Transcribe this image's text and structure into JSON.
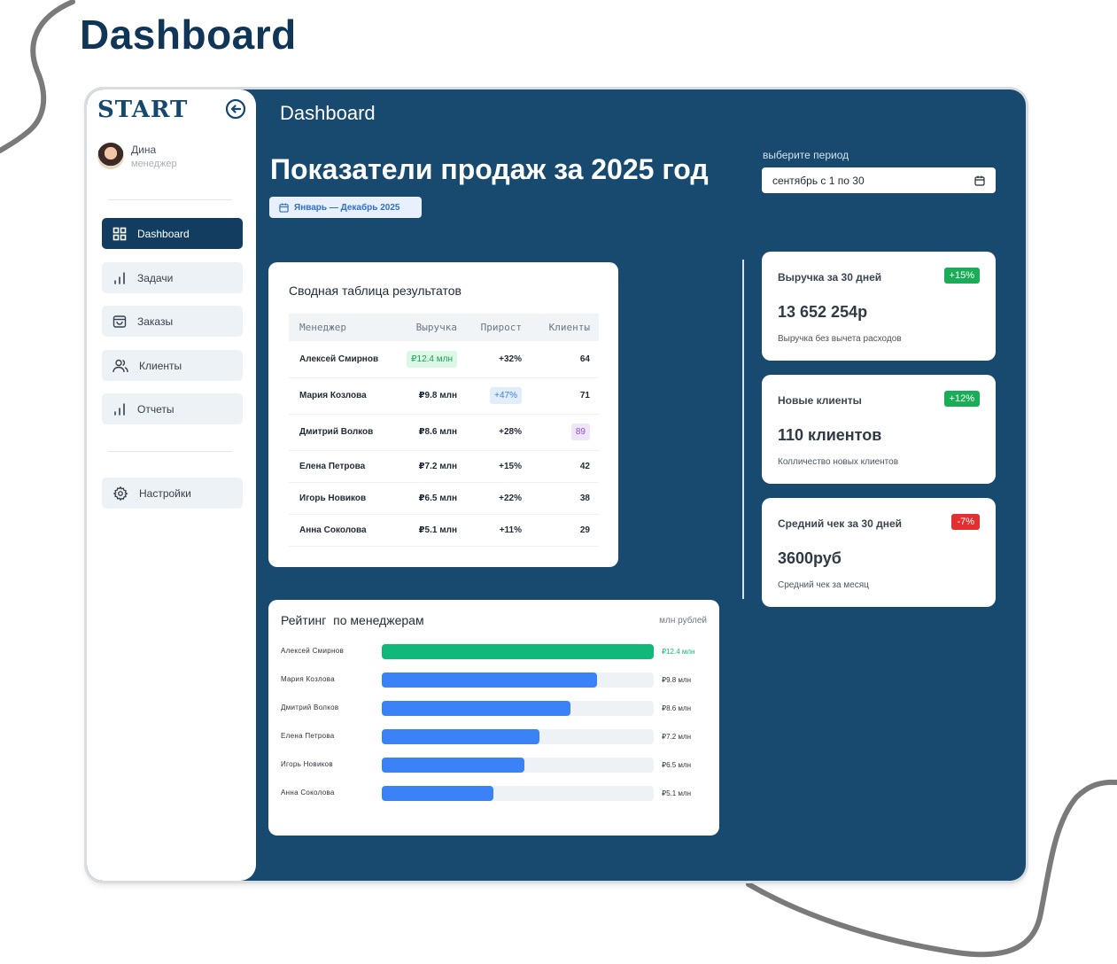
{
  "page_title": "Dashboard",
  "sidebar": {
    "brand": "START",
    "user": {
      "name": "Дина",
      "role": "менеджер"
    },
    "items": [
      {
        "label": "Dashboard",
        "icon": "grid-icon",
        "active": true
      },
      {
        "label": "Задачи",
        "icon": "bar-chart-icon"
      },
      {
        "label": "Заказы",
        "icon": "shopping-bag-icon"
      },
      {
        "label": "Клиенты",
        "icon": "users-icon"
      },
      {
        "label": "Отчеты",
        "icon": "bar-chart-icon"
      }
    ],
    "settings": {
      "label": "Настройки",
      "icon": "gear-icon"
    }
  },
  "header": {
    "title": "Dashboard",
    "hero": "Показатели продаж за 2025 год",
    "range_label": "Январь — Декабрь 2025",
    "period_label": "выберите период",
    "period_value": "сентябрь с 1 по 30"
  },
  "summary_table": {
    "title": "Сводная таблица результатов",
    "columns": [
      "Менеджер",
      "Выручка",
      "Прирост",
      "Клиенты"
    ],
    "rows": [
      {
        "name": "Алексей Смирнов",
        "revenue": "₽12.4 млн",
        "growth": "+32%",
        "clients": "64"
      },
      {
        "name": "Мария Козлова",
        "revenue": "₽9.8 млн",
        "growth": "+47%",
        "clients": "71"
      },
      {
        "name": "Дмитрий Волков",
        "revenue": "₽8.6 млн",
        "growth": "+28%",
        "clients": "89"
      },
      {
        "name": "Елена Петрова",
        "revenue": "₽7.2 млн",
        "growth": "+15%",
        "clients": "42"
      },
      {
        "name": "Игорь Новиков",
        "revenue": "₽6.5 млн",
        "growth": "+22%",
        "clients": "38"
      },
      {
        "name": "Анна Соколова",
        "revenue": "₽5.1 млн",
        "growth": "+11%",
        "clients": "29"
      }
    ]
  },
  "kpis": [
    {
      "title": "Выручка за 30 дней",
      "badge": "+15%",
      "value": "13 652 254р",
      "sub": "Выручка без вычета расходов"
    },
    {
      "title": "Новые клиенты",
      "badge": "+12%",
      "value": "110 клиентов",
      "sub": "Колличество новых клиентов"
    },
    {
      "title": "Средний чек за 30 дней",
      "badge": "-7%",
      "value": "3600руб",
      "sub": "Средний чек за месяц"
    }
  ],
  "ranking": {
    "title": "Рейтинг  по менеджерам",
    "unit": "млн рублей",
    "rows": [
      {
        "name": "Алексей Смирнов",
        "label": "₽12.4 млн",
        "value": 12.4
      },
      {
        "name": "Мария Козлова",
        "label": "₽9.8 млн",
        "value": 9.8
      },
      {
        "name": "Дмитрий Волков",
        "label": "₽8.6 млн",
        "value": 8.6
      },
      {
        "name": "Елена Петрова",
        "label": "₽7.2 млн",
        "value": 7.2
      },
      {
        "name": "Игорь Новиков",
        "label": "₽6.5 млн",
        "value": 6.5
      },
      {
        "name": "Анна Соколова",
        "label": "₽5.1 млн",
        "value": 5.1
      }
    ],
    "max_value": 12.4
  },
  "colors": {
    "navy": "#18496f",
    "accent_green": "#12b87a",
    "accent_blue": "#3b82f6",
    "badge_up": "#1aad57",
    "badge_down": "#e23030"
  }
}
